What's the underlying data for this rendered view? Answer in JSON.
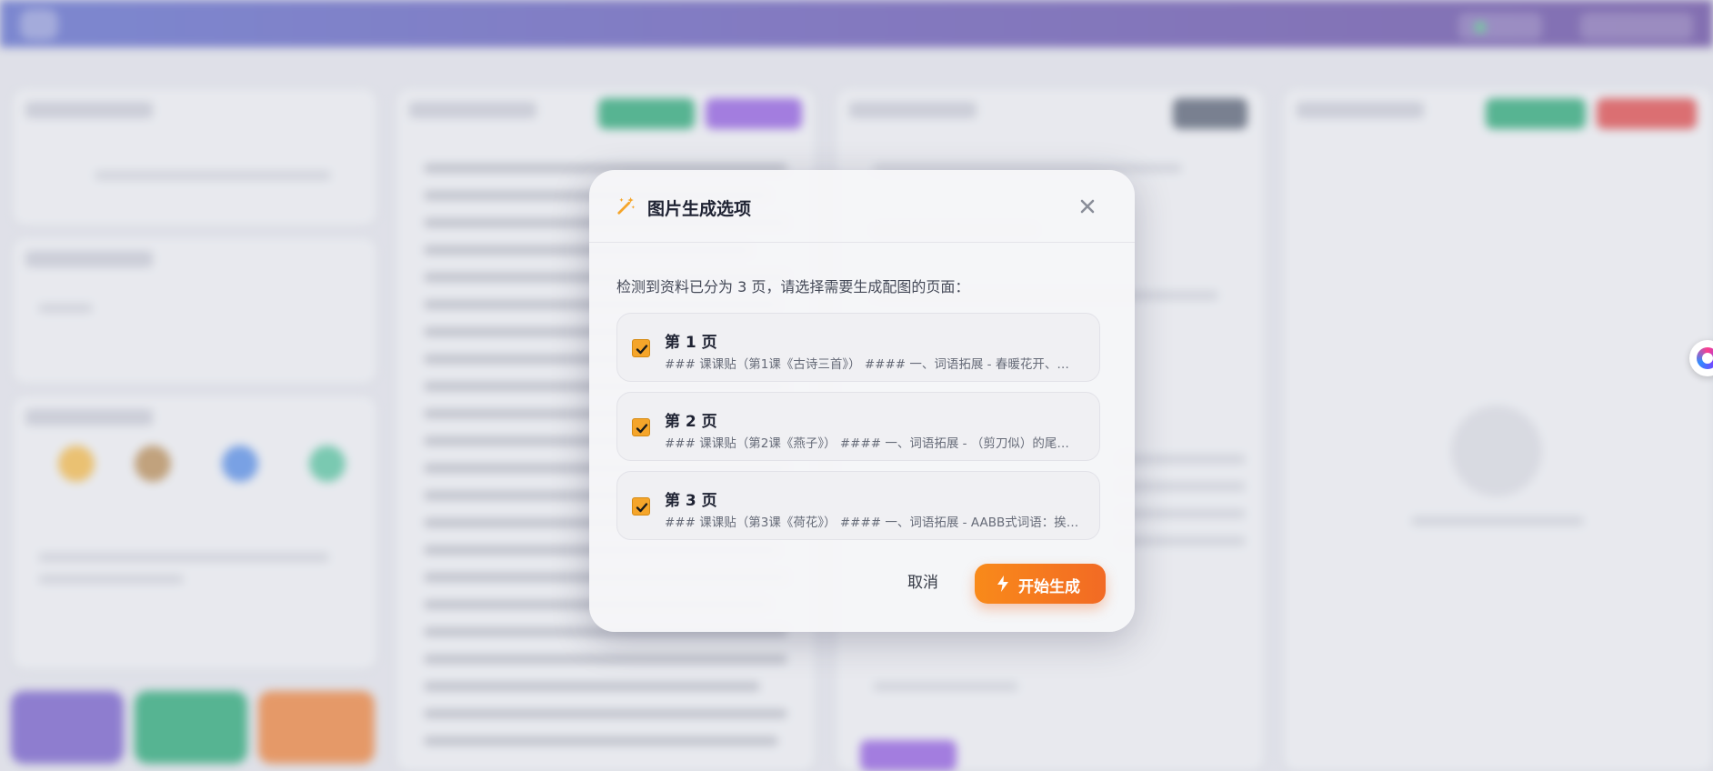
{
  "modal": {
    "title": "图片生成选项",
    "instruction": "检测到资料已分为 3 页，请选择需要生成配图的页面：",
    "pages": [
      {
        "title": "第 1 页",
        "preview": "### 课课贴（第1课《古诗三首》） #### 一、词语拓展 - 春暖花开、…",
        "checked": true
      },
      {
        "title": "第 2 页",
        "preview": "### 课课贴（第2课《燕子》） #### 一、词语拓展 - （剪刀似）的尾…",
        "checked": true
      },
      {
        "title": "第 3 页",
        "preview": "### 课课贴（第3课《荷花》） #### 一、词语拓展 - AABB式词语：挨…",
        "checked": true
      }
    ],
    "cancel_label": "取消",
    "start_label": "开始生成"
  },
  "icons": {
    "header": "magic-wand-icon",
    "close": "close-icon",
    "start": "lightning-icon",
    "checkbox": "checkmark-icon",
    "assistant": "assistant-fab-icon"
  },
  "colors": {
    "accent": "#f98a1a",
    "checkbox": "#f5a52a",
    "header_bar": "#5a49b0"
  }
}
